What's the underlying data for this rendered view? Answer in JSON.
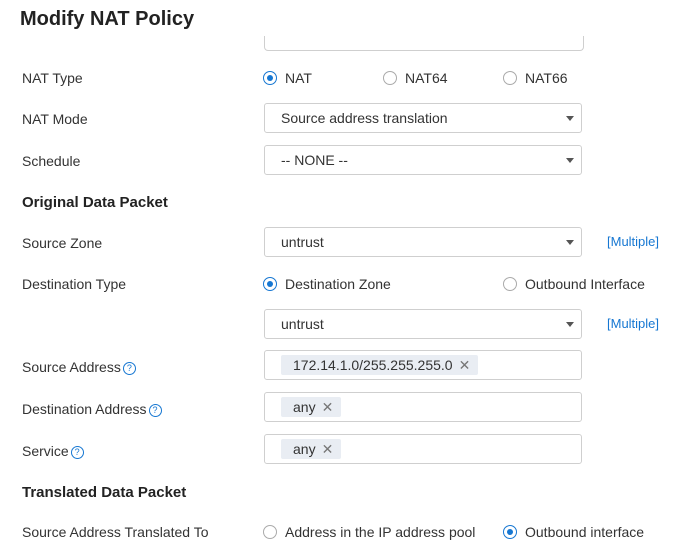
{
  "header": {
    "title": "Modify NAT Policy"
  },
  "nat_type": {
    "label": "NAT Type",
    "options": [
      "NAT",
      "NAT64",
      "NAT66"
    ],
    "selected": "NAT"
  },
  "nat_mode": {
    "label": "NAT Mode",
    "value": "Source address translation"
  },
  "schedule": {
    "label": "Schedule",
    "value": "-- NONE --"
  },
  "original": {
    "title": "Original Data Packet",
    "source_zone": {
      "label": "Source Zone",
      "value": "untrust",
      "multiple": "[Multiple]"
    },
    "destination_type": {
      "label": "Destination Type",
      "options": [
        "Destination Zone",
        "Outbound Interface"
      ],
      "selected": "Destination Zone",
      "zone_value": "untrust",
      "multiple": "[Multiple]"
    },
    "source_address": {
      "label": "Source Address",
      "tag": "172.14.1.0/255.255.255.0"
    },
    "destination_address": {
      "label": "Destination Address",
      "tag": "any"
    },
    "service": {
      "label": "Service",
      "tag": "any"
    }
  },
  "translated": {
    "title": "Translated Data Packet",
    "source_translated": {
      "label": "Source Address Translated To",
      "options": [
        "Address in the IP address pool",
        "Outbound interface"
      ],
      "selected": "Outbound interface"
    }
  },
  "icons": {
    "help": "question-circle-icon",
    "remove": "close-icon",
    "dropdown": "chevron-down-icon"
  },
  "colors": {
    "accent": "#1677d2"
  }
}
